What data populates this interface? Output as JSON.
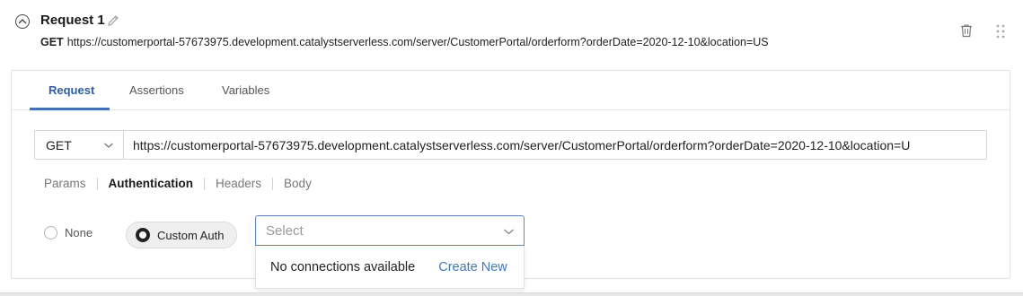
{
  "request": {
    "title": "Request 1",
    "method": "GET",
    "url": "https://customerportal-57673975.development.catalystserverless.com/server/CustomerPortal/orderform?orderDate=2020-12-10&location=US"
  },
  "tabs": [
    {
      "label": "Request",
      "active": true
    },
    {
      "label": "Assertions",
      "active": false
    },
    {
      "label": "Variables",
      "active": false
    }
  ],
  "url_bar": {
    "method": "GET",
    "url_value": "https://customerportal-57673975.development.catalystserverless.com/server/CustomerPortal/orderform?orderDate=2020-12-10&location=U"
  },
  "subtabs": [
    {
      "label": "Params",
      "active": false
    },
    {
      "label": "Authentication",
      "active": true
    },
    {
      "label": "Headers",
      "active": false
    },
    {
      "label": "Body",
      "active": false
    }
  ],
  "auth": {
    "option_none": "None",
    "option_custom": "Custom Auth",
    "selected": "Custom Auth",
    "select_placeholder": "Select",
    "dropdown_empty": "No connections available",
    "create_new": "Create New"
  },
  "icons": {
    "collapse": "chevron-up-circle-icon",
    "edit": "pencil-icon",
    "delete": "trash-icon",
    "drag": "drag-handle-icon",
    "method_chevron": "chevron-down-icon",
    "select_chevron": "chevron-down-icon"
  },
  "colors": {
    "accent": "#3d6fc7",
    "link": "#3d78c9",
    "select_border": "#5b86d6"
  }
}
